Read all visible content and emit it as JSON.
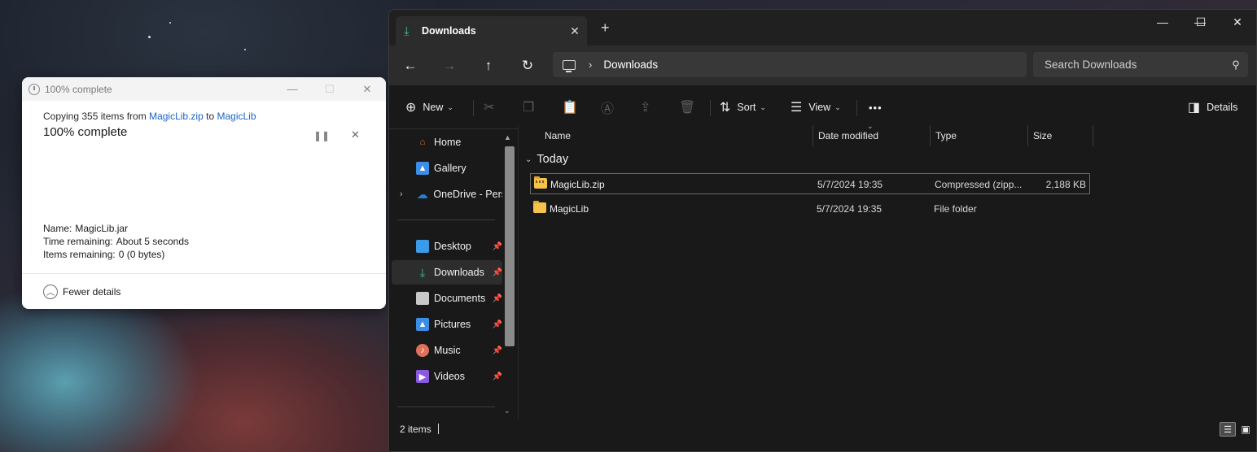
{
  "dialog": {
    "title": "100% complete",
    "copy_prefix": "Copying 355 items from",
    "copy_source": "MagicLib.zip",
    "copy_to": "to",
    "copy_dest": "MagicLib",
    "progress_label": "100% complete",
    "progress_percent": 100,
    "details": [
      {
        "label": "Name:",
        "value": "MagicLib.jar"
      },
      {
        "label": "Time remaining:",
        "value": "About 5 seconds"
      },
      {
        "label": "Items remaining:",
        "value": "0 (0 bytes)"
      }
    ],
    "fewer_details": "Fewer details"
  },
  "explorer": {
    "tab_label": "Downloads",
    "new_tab": "+",
    "breadcrumb": "Downloads",
    "search_placeholder": "Search Downloads",
    "commands": {
      "new": "New",
      "sort": "Sort",
      "view": "View",
      "more": "•••",
      "details": "Details"
    },
    "sidebar": [
      {
        "label": "Home",
        "icon": "home-icon",
        "color": "#e8773a"
      },
      {
        "label": "Gallery",
        "icon": "gallery-icon",
        "color": "#3a8ee8"
      },
      {
        "label": "OneDrive - Perso",
        "icon": "onedrive-icon",
        "color": "#2b7cd3"
      },
      {
        "label": "Desktop",
        "icon": "desktop-icon",
        "color": "#3a9be8"
      },
      {
        "label": "Downloads",
        "icon": "download-icon",
        "color": "#3fbf9b"
      },
      {
        "label": "Documents",
        "icon": "documents-icon",
        "color": "#c8c8c8"
      },
      {
        "label": "Pictures",
        "icon": "pictures-icon",
        "color": "#3a8ee8"
      },
      {
        "label": "Music",
        "icon": "music-icon",
        "color": "#e0705a"
      },
      {
        "label": "Videos",
        "icon": "videos-icon",
        "color": "#8a5ae0"
      }
    ],
    "columns": [
      "Name",
      "Date modified",
      "Type",
      "Size"
    ],
    "group": "Today",
    "files": [
      {
        "name": "MagicLib.zip",
        "date": "5/7/2024 19:35",
        "type": "Compressed (zipp...",
        "size": "2,188 KB"
      },
      {
        "name": "MagicLib",
        "date": "5/7/2024 19:35",
        "type": "File folder",
        "size": ""
      }
    ],
    "status": "2 items"
  }
}
